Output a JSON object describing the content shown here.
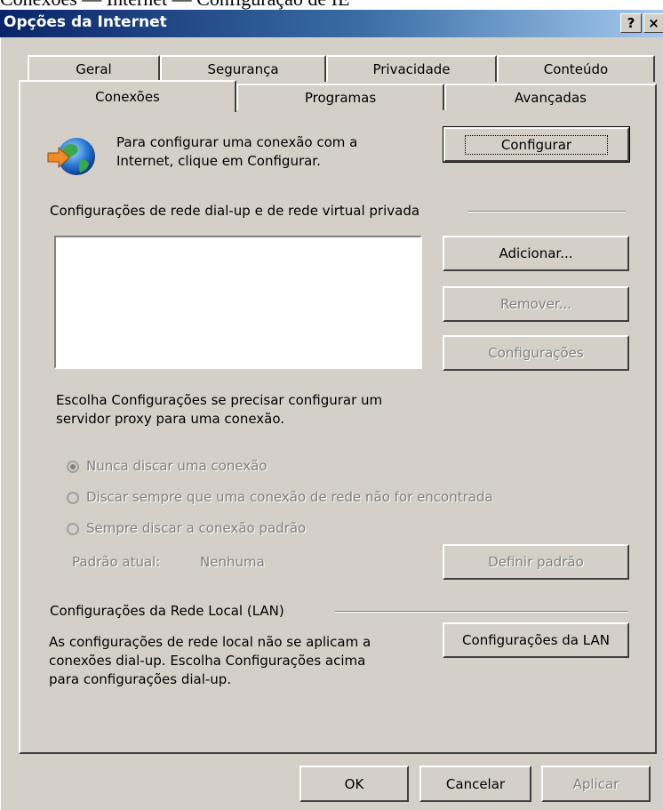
{
  "window": {
    "caption_above": "Conexões — Internet — Configuração de IE",
    "title": "Opções da Internet",
    "help_btn": "?",
    "close_btn": "×"
  },
  "tabs_row1": [
    "Geral",
    "Segurança",
    "Privacidade",
    "Conteúdo"
  ],
  "tabs_row2": [
    "Conexões",
    "Programas",
    "Avançadas"
  ],
  "setup": {
    "text_line1": "Para configurar uma conexão com a",
    "text_line2": "Internet, clique em Configurar.",
    "button": "Configurar"
  },
  "dialup": {
    "group_label": "Configurações de rede dial-up e de rede virtual privada",
    "list_items": [],
    "add_button": "Adicionar...",
    "remove_button": "Remover...",
    "settings_button": "Configurações",
    "proxy_line1": "Escolha Configurações se precisar configurar um",
    "proxy_line2": "servidor proxy para uma conexão."
  },
  "dial_options": {
    "never": "Nunca discar uma conexão",
    "when_needed": "Discar sempre que uma conexão de rede não for encontrada",
    "always": "Sempre discar a conexão padrão",
    "selected": "never",
    "current_label": "Padrão atual:",
    "current_value": "Nenhuma",
    "set_default_button": "Definir padrão"
  },
  "lan": {
    "group_label": "Configurações da Rede Local (LAN)",
    "line1": "As configurações de rede local não se aplicam a",
    "line2": "conexões dial-up. Escolha Configurações acima",
    "line3": "para configurações dial-up.",
    "button": "Configurações da LAN"
  },
  "footer": {
    "ok": "OK",
    "cancel": "Cancelar",
    "apply": "Aplicar"
  }
}
